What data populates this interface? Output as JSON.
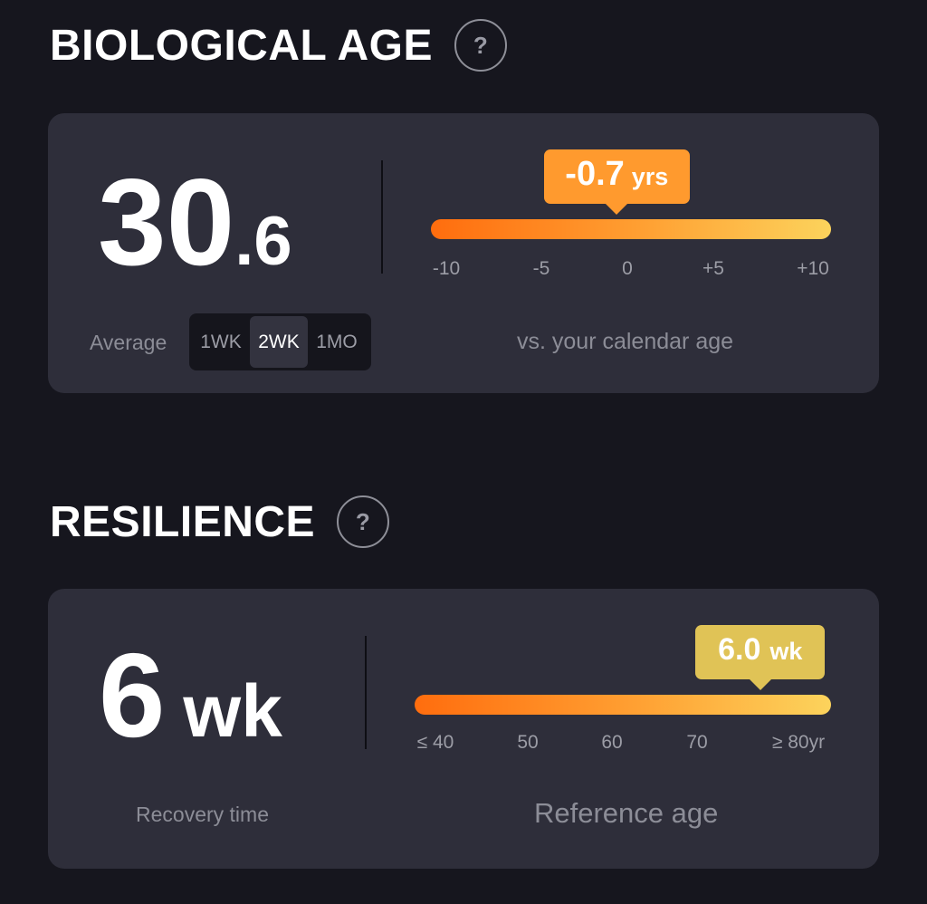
{
  "bio": {
    "title": "BIOLOGICAL AGE",
    "help": "?",
    "value_int": "30",
    "value_dec": ".6",
    "average_label": "Average",
    "periods": [
      "1WK",
      "2WK",
      "1MO"
    ],
    "active_period": "2WK",
    "delta_value": "-0.7",
    "delta_unit": "yrs",
    "delta_number": -0.7,
    "scale": {
      "min": -10,
      "max": 10,
      "ticks": [
        "-10",
        "-5",
        "0",
        "+5",
        "+10"
      ]
    },
    "caption": "vs. your calendar age",
    "colors": {
      "badge": "#ff9a2e"
    }
  },
  "resilience": {
    "title": "RESILIENCE",
    "help": "?",
    "value": "6",
    "unit": "wk",
    "caption_left": "Recovery time",
    "badge_value": "6.0",
    "badge_unit": "wk",
    "marker_fraction": 0.83,
    "ticks": [
      "≤ 40",
      "50",
      "60",
      "70",
      "≥ 80yr"
    ],
    "caption": "Reference age",
    "colors": {
      "badge": "#e0c356"
    }
  }
}
